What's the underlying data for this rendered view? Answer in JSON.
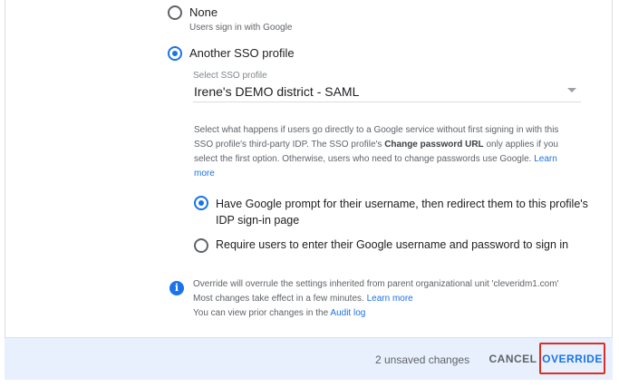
{
  "options": {
    "none": {
      "label": "None",
      "hint": "Users sign in with Google",
      "selected": false
    },
    "another_sso": {
      "label": "Another SSO profile",
      "selected": true
    }
  },
  "sso_select": {
    "caption": "Select SSO profile",
    "value": "Irene's DEMO district - SAML"
  },
  "description": {
    "line1": "Select what happens if users go directly to a Google service without first signing in with this",
    "line2_pre": "SSO profile's third-party IDP. The SSO profile's ",
    "line2_bold": "Change password URL",
    "line2_post": " only applies if you",
    "line3_pre": "select the first option. Otherwise, users who need to change passwords use Google. ",
    "line3_link": "Learn",
    "line4_link": "more"
  },
  "sub_options": {
    "prompt": {
      "line1": "Have Google prompt for their username, then redirect them to this profile's",
      "line2": "IDP sign-in page",
      "selected": true
    },
    "require": {
      "label": "Require users to enter their Google username and password to sign in",
      "selected": false
    }
  },
  "info": {
    "icon": "info-icon",
    "line1": "Override will overrule the settings inherited from parent organizational unit 'cleveridm1.com'",
    "line2_pre": "Most changes take effect in a few minutes. ",
    "line2_link": "Learn more",
    "line3_pre": "You can view prior changes in the ",
    "line3_link": "Audit log"
  },
  "footer": {
    "unsaved": "2 unsaved changes",
    "cancel": "CANCEL",
    "override": "OVERRIDE"
  },
  "colors": {
    "accent": "#1a73e8",
    "footer_bg": "#e8f0fe",
    "highlight_border": "#d93025"
  }
}
